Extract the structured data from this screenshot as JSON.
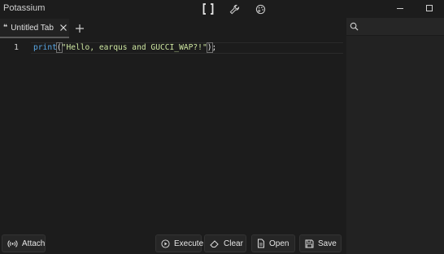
{
  "app": {
    "title": "Potassium"
  },
  "tabs": [
    {
      "label": "Untitled Tab",
      "icon": "quote-icon"
    }
  ],
  "editor": {
    "line_number": "1",
    "code": {
      "fn": "print",
      "open": "(",
      "str": "\"Hello, earqus and GUCCI_WAP?!\"",
      "close": ")",
      "end": ";"
    }
  },
  "search": {
    "placeholder": "",
    "value": ""
  },
  "buttons": {
    "attach": "Attach",
    "execute": "Execute",
    "clear": "Clear",
    "open": "Open",
    "save": "Save"
  },
  "colors": {
    "background": "#1c1c1c",
    "panel": "#222222",
    "function": "#5aa8e6",
    "string": "#cde6a0"
  }
}
